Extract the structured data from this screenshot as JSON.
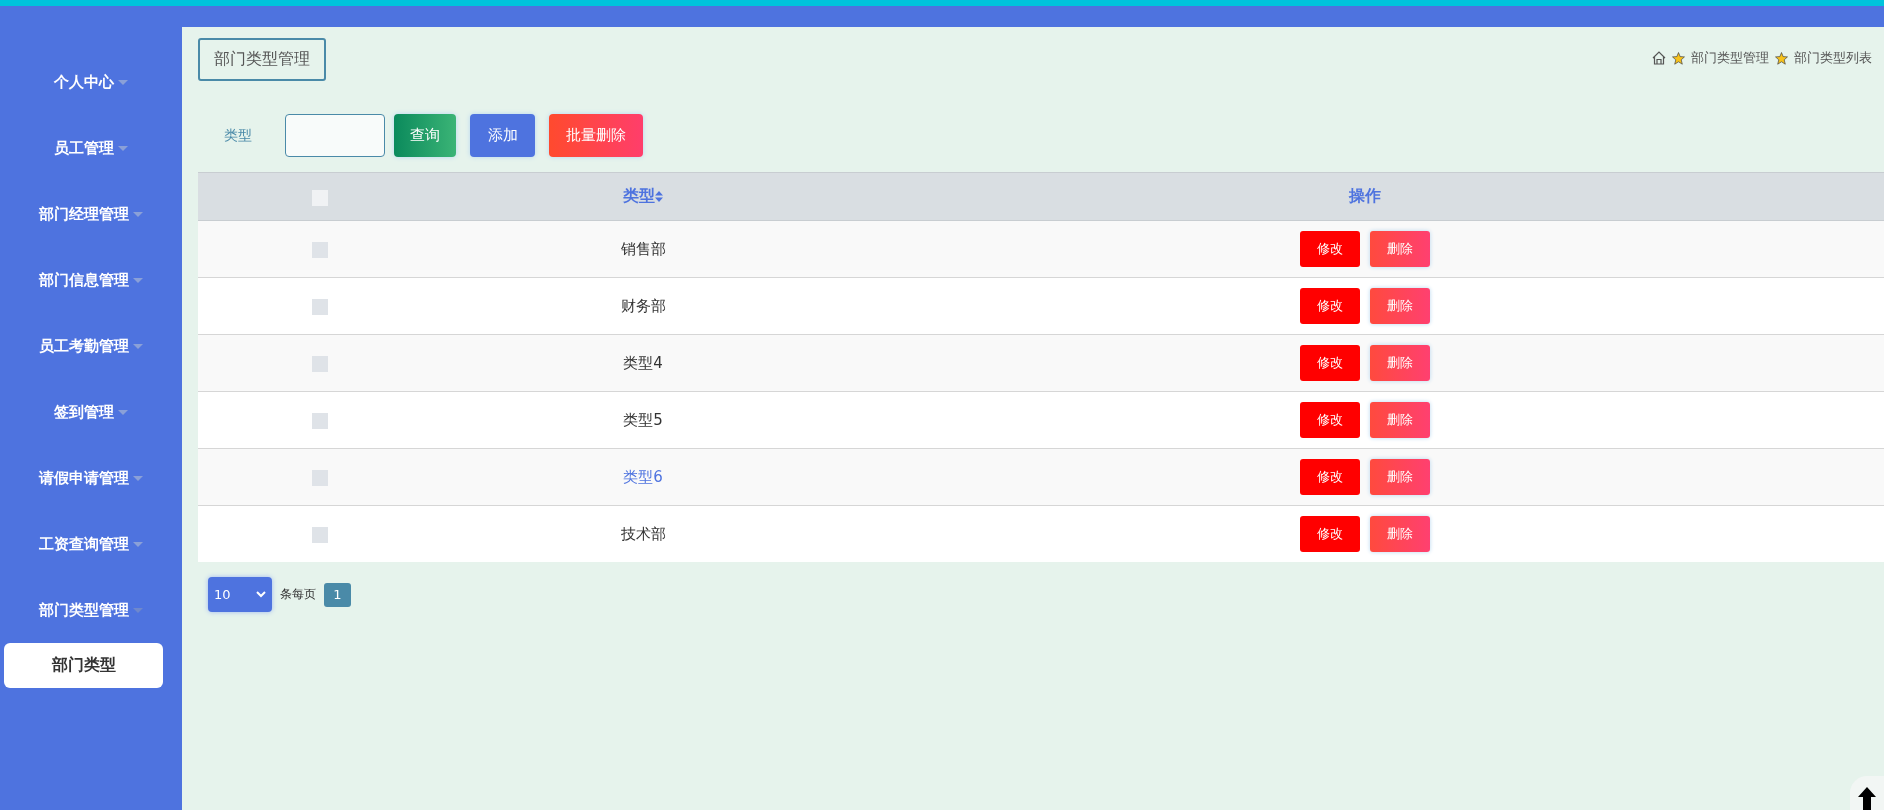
{
  "sidebar": {
    "items": [
      {
        "label": "个人中心",
        "expanded": false
      },
      {
        "label": "员工管理",
        "expanded": false
      },
      {
        "label": "部门经理管理",
        "expanded": false
      },
      {
        "label": "部门信息管理",
        "expanded": false
      },
      {
        "label": "员工考勤管理",
        "expanded": false
      },
      {
        "label": "签到管理",
        "expanded": false
      },
      {
        "label": "请假申请管理",
        "expanded": false
      },
      {
        "label": "工资查询管理",
        "expanded": false
      },
      {
        "label": "部门类型管理",
        "expanded": true,
        "children": [
          {
            "label": "部门类型",
            "selected": true
          }
        ]
      }
    ]
  },
  "page_title": "部门类型管理",
  "breadcrumb": [
    "部门类型管理",
    "部门类型列表"
  ],
  "search": {
    "label": "类型"
  },
  "buttons": [
    {
      "label": "查询",
      "kind": "search"
    },
    {
      "label": "添加",
      "kind": "add"
    },
    {
      "label": "批量删除",
      "kind": "batch-delete"
    }
  ],
  "table": {
    "select_all_checked": false,
    "columns": [
      {
        "label": "类型",
        "sortable": true
      },
      {
        "label": "操作",
        "sortable": false
      }
    ],
    "rows": [
      {
        "type": "销售部",
        "checked": false,
        "hovered": false,
        "actions": [
          "修改",
          "删除"
        ]
      },
      {
        "type": "财务部",
        "checked": false,
        "hovered": false,
        "actions": [
          "修改",
          "删除"
        ]
      },
      {
        "type": "类型4",
        "checked": false,
        "hovered": false,
        "actions": [
          "修改",
          "删除"
        ]
      },
      {
        "type": "类型5",
        "checked": false,
        "hovered": false,
        "actions": [
          "修改",
          "删除"
        ]
      },
      {
        "type": "类型6",
        "checked": false,
        "hovered": true,
        "actions": [
          "修改",
          "删除"
        ]
      },
      {
        "type": "技术部",
        "checked": false,
        "hovered": false,
        "actions": [
          "修改",
          "删除"
        ]
      }
    ]
  },
  "pagination": {
    "page_size": "10",
    "per_page_label": "条每页",
    "pages": [
      {
        "label": "1",
        "selected": true
      }
    ]
  }
}
